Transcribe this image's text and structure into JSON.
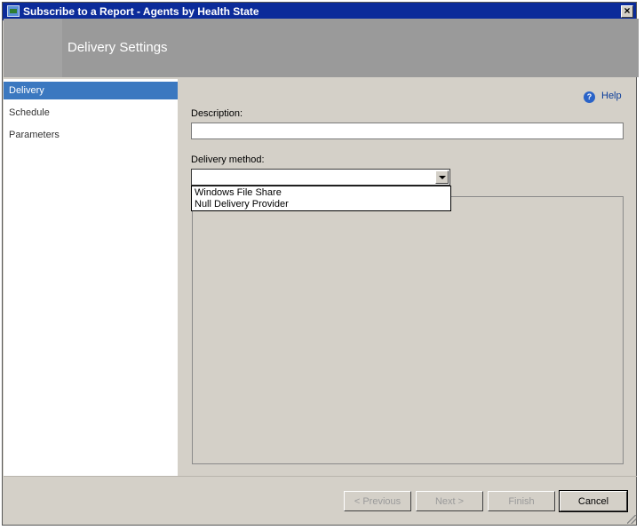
{
  "window": {
    "title": "Subscribe to a Report - Agents by Health State",
    "close_glyph": "×"
  },
  "header": {
    "title": "Delivery Settings"
  },
  "nav": {
    "items": [
      {
        "label": "Delivery",
        "active": true
      },
      {
        "label": "Schedule",
        "active": false
      },
      {
        "label": "Parameters",
        "active": false
      }
    ]
  },
  "help": {
    "icon_glyph": "?",
    "label": "Help"
  },
  "form": {
    "description_label": "Description:",
    "description_value": "",
    "delivery_method_label": "Delivery method:",
    "delivery_method_value": "",
    "delivery_options": [
      "Windows File Share",
      "Null Delivery Provider"
    ]
  },
  "buttons": {
    "previous": "< Previous",
    "next": "Next >",
    "finish": "Finish",
    "cancel": "Cancel"
  },
  "colors": {
    "titlebar": "#0b2b9a",
    "header_band": "#9a9a9a",
    "nav_active": "#3b78c0",
    "dialog_bg": "#d4d0c8"
  }
}
